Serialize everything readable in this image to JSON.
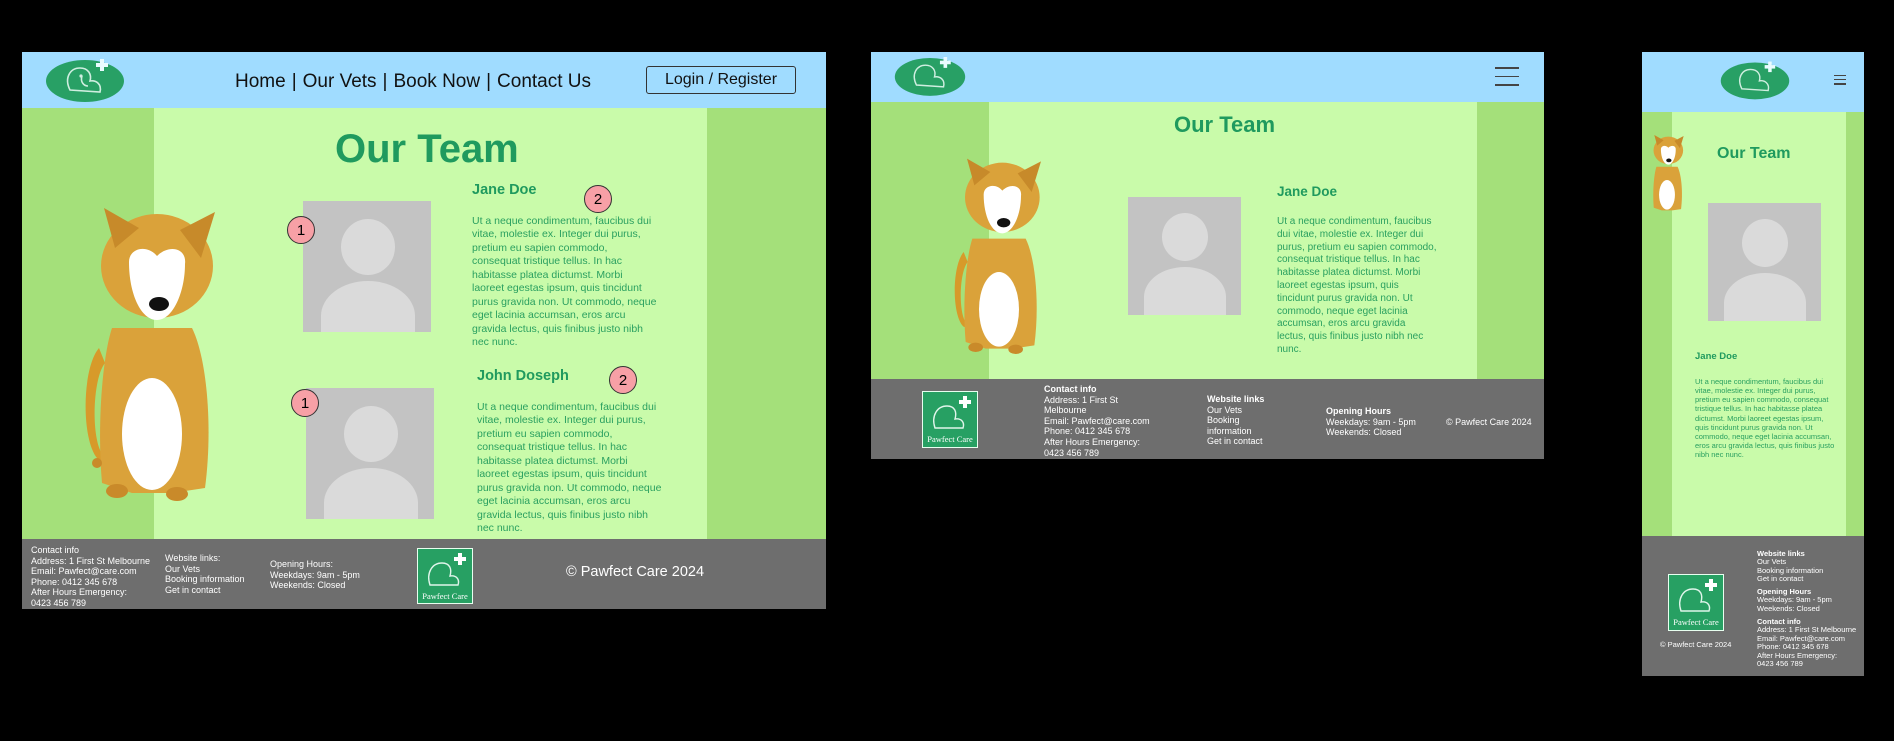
{
  "brand": {
    "name": "Pawfect Care",
    "colors": {
      "header": "#a0dcff",
      "side": "#a4e07a",
      "main": "#c9fbaa",
      "footer": "#6e6e6e",
      "accent": "#1f9a5e"
    }
  },
  "nav": {
    "home": "Home",
    "vets": "Our Vets",
    "book": "Book Now",
    "contact": "Contact Us",
    "separator": "|"
  },
  "login": "Login / Register",
  "hamburger_icon": "menu-icon",
  "page_title": "Our Team",
  "members": [
    {
      "name": "Jane Doe",
      "bio": "Ut a neque condimentum, faucibus dui vitae, molestie ex. Integer dui  purus, pretium eu sapien commodo, consequat tristique tellus. In hac habitasse platea dictumst. Morbi laoreet egestas ipsum, quis tincidunt  purus gravida non. Ut commodo, neque eget lacinia accumsan, eros arcu  gravida lectus, quis finibus justo nibh nec nunc."
    },
    {
      "name": "John Doseph",
      "bio": "Ut a neque condimentum, faucibus dui vitae, molestie ex. Integer dui purus, pretium eu sapien commodo, consequat tristique tellus. In hac habitasse platea dictumst. Morbi laoreet egestas ipsum, quis tincidunt  purus gravida non. Ut commodo, neque eget lacinia accumsan, eros arcu  gravida lectus, quis finibus justo nibh nec nunc."
    }
  ],
  "annotations": {
    "one": "1",
    "two": "2"
  },
  "footer": {
    "contact_title": "Contact info",
    "address": "Address: 1 First St Melbourne",
    "address_line1": "Address: 1 First St",
    "address_line2": "Melbourne",
    "email": "Email: Pawfect@care.com",
    "phone": "Phone: 0412 345 678",
    "emergency": "After Hours Emergency:",
    "emergency_number": "0423 456 789",
    "links_title": "Website links:",
    "links_title_short": "Website links",
    "links": [
      "Our Vets",
      "Booking information",
      "Get in contact"
    ],
    "links_tablet": [
      "Our Vets",
      "Booking",
      "information",
      "Get in contact"
    ],
    "hours_title": "Opening Hours:",
    "hours_title_short": "Opening Hours",
    "weekdays": "Weekdays: 9am - 5pm",
    "weekends": "Weekends: Closed",
    "copyright_big": "© Pawfect Care 2024",
    "copyright": "© Pawfect Care 2024"
  }
}
